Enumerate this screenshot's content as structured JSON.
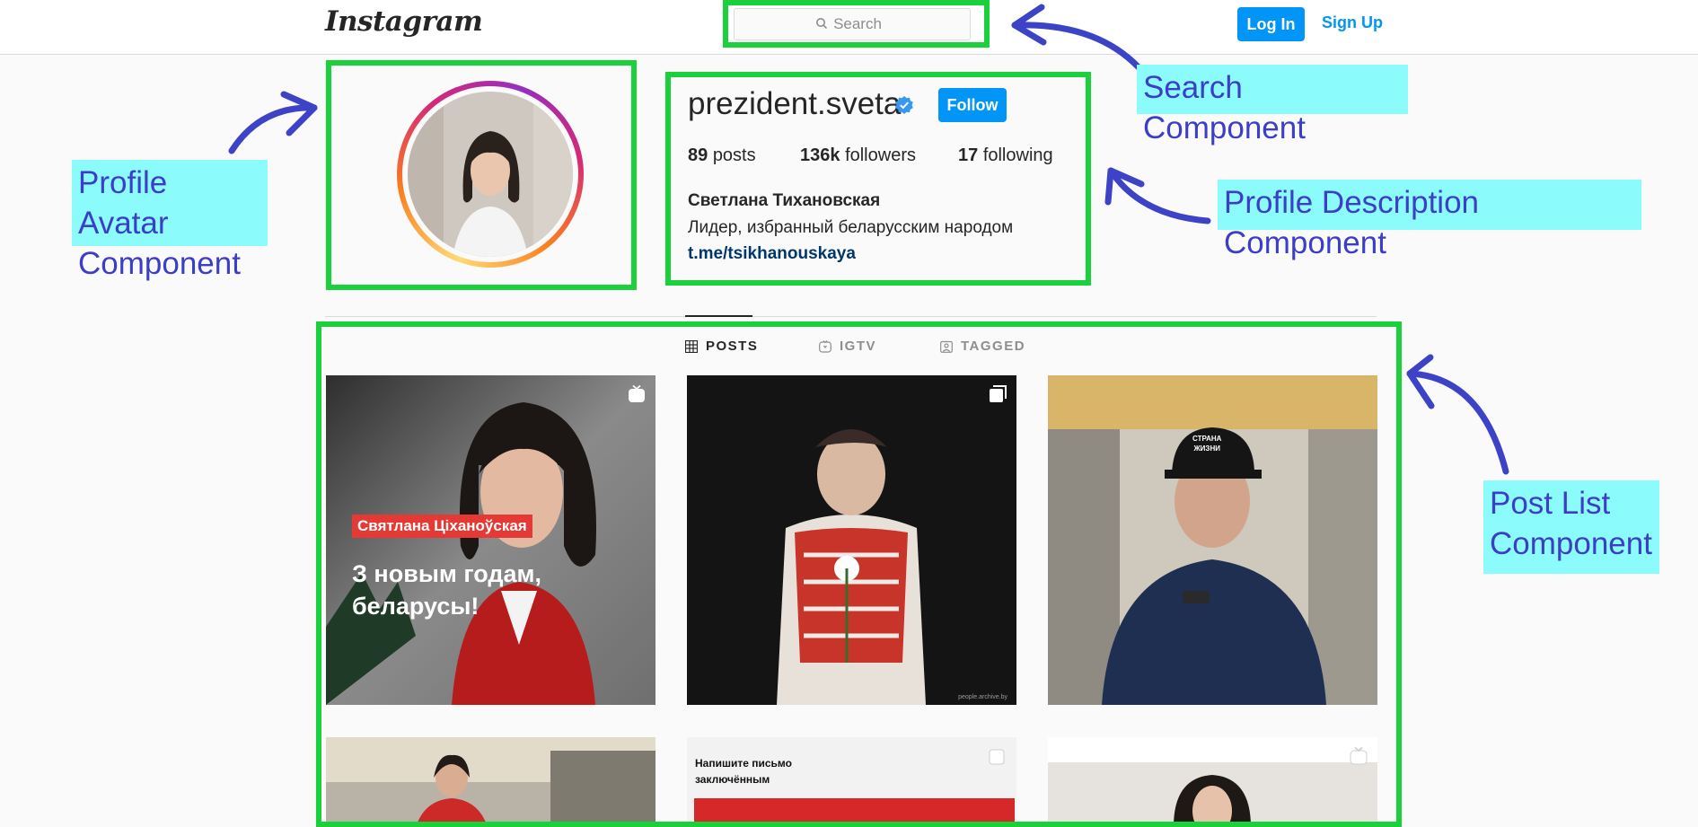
{
  "nav": {
    "logo": "Instagram",
    "search_placeholder": "Search",
    "login_label": "Log In",
    "signup_label": "Sign Up"
  },
  "profile": {
    "username": "prezident.sveta",
    "follow_label": "Follow",
    "posts_count": "89",
    "posts_label": "posts",
    "followers_count": "136k",
    "followers_label": "followers",
    "following_count": "17",
    "following_label": "following",
    "full_name": "Светлана Тихановская",
    "bio": "Лидер, избранный беларусским народом",
    "link": "t.me/tsikhanouskaya"
  },
  "tabs": [
    {
      "label": "POSTS",
      "icon": "grid-icon",
      "active": true
    },
    {
      "label": "IGTV",
      "icon": "igtv-icon",
      "active": false
    },
    {
      "label": "TAGGED",
      "icon": "tagged-icon",
      "active": false
    }
  ],
  "posts": {
    "p1": {
      "caption_tag": "Святлана Ціханоўская",
      "caption_line1": "З новым годам,",
      "caption_line2": "беларусы!",
      "icon": "igtv-icon"
    },
    "p2": {
      "credit": "people.archive.by",
      "icon": "carousel-icon"
    },
    "p3": {
      "cap_text1": "СТРАНА",
      "cap_text2": "ЖИЗНИ"
    },
    "p5": {
      "title": "Напишите письмо заключённым",
      "icon": "carousel-icon"
    },
    "p6": {
      "icon": "igtv-icon"
    }
  },
  "annotations": {
    "search": "Search Component",
    "avatar": "Profile Avatar Component",
    "description": "Profile Description Component",
    "posts": "Post List Component"
  },
  "colors": {
    "primary_blue": "#0095f6",
    "frame_green": "#1bd13b",
    "label_bg": "#8cfbfb",
    "label_text": "#3a3ec8",
    "arrow": "#3d43c6"
  }
}
